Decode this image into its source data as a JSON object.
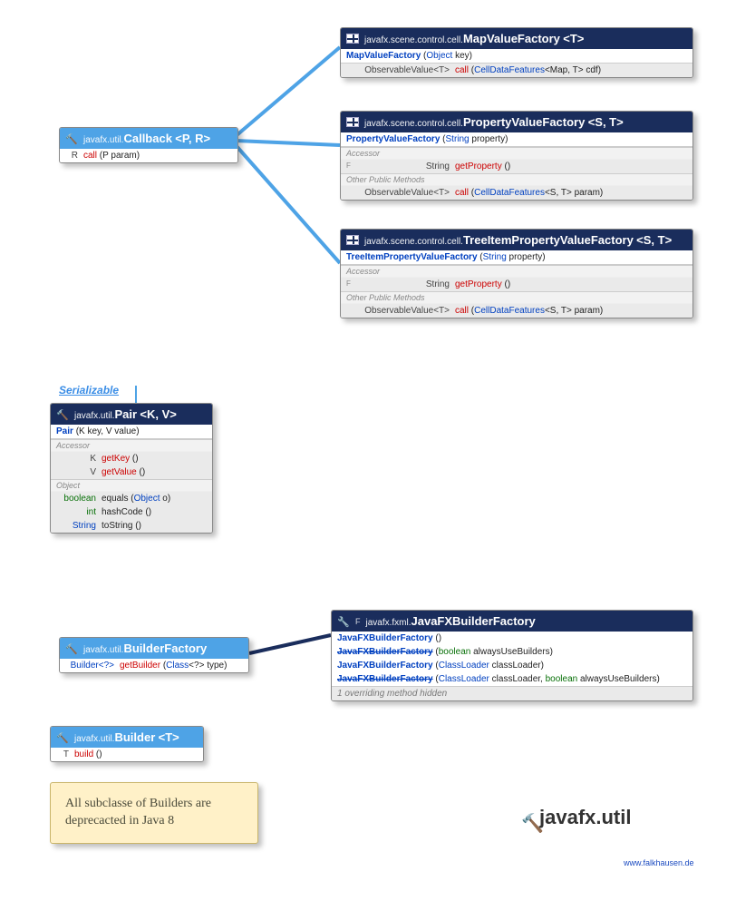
{
  "callback": {
    "pkg": "javafx.util.",
    "cls": "Callback",
    "gen": "<P, R>",
    "row1_ret": "R",
    "row1_name": "call",
    "row1_args": "(P param)"
  },
  "mapValueFactory": {
    "pkg": "javafx.scene.control.cell.",
    "cls": "MapValueFactory",
    "gen": "<T>",
    "ctor_name": "MapValueFactory",
    "ctor_args_pre": "(",
    "ctor_args_type": "Object",
    "ctor_args_post": " key)",
    "row_ret": "ObservableValue<T>",
    "row_name": "call",
    "row_args_pre": "(",
    "row_args_type": "CellDataFeatures",
    "row_args_gen": "<Map, T>",
    "row_args_post": " cdf)"
  },
  "propertyValueFactory": {
    "pkg": "javafx.scene.control.cell.",
    "cls": "PropertyValueFactory",
    "gen": "<S, T>",
    "ctor_name": "PropertyValueFactory",
    "ctor_args_pre": "(",
    "ctor_args_type": "String",
    "ctor_args_post": " property)",
    "sec_accessor": "Accessor",
    "acc_f": "F",
    "acc_ret": "String",
    "acc_name": "getProperty",
    "acc_args": "()",
    "sec_other": "Other Public Methods",
    "row_ret": "ObservableValue<T>",
    "row_name": "call",
    "row_args_pre": "(",
    "row_args_type": "CellDataFeatures",
    "row_args_gen": "<S, T>",
    "row_args_post": " param)"
  },
  "treeItemPVF": {
    "pkg": "javafx.scene.control.cell.",
    "cls": "TreeItemPropertyValueFactory",
    "gen": "<S, T>",
    "ctor_name": "TreeItemPropertyValueFactory",
    "ctor_args_pre": "(",
    "ctor_args_type": "String",
    "ctor_args_post": " property)",
    "sec_accessor": "Accessor",
    "acc_f": "F",
    "acc_ret": "String",
    "acc_name": "getProperty",
    "acc_args": "()",
    "sec_other": "Other Public Methods",
    "row_ret": "ObservableValue<T>",
    "row_name": "call",
    "row_args_pre": "(",
    "row_args_type": "CellDataFeatures",
    "row_args_gen": "<S, T>",
    "row_args_post": " param)"
  },
  "serializable_label": "Serializable",
  "pair": {
    "pkg": "javafx.util.",
    "cls": "Pair",
    "gen": "<K, V>",
    "ctor_name": "Pair",
    "ctor_args": "(K key, V value)",
    "sec_accessor": "Accessor",
    "r1_ret": "K",
    "r1_name": "getKey",
    "r1_args": "()",
    "r2_ret": "V",
    "r2_name": "getValue",
    "r2_args": "()",
    "sec_object": "Object",
    "r3_ret": "boolean",
    "r3_name": "equals",
    "r3_args_pre": "(",
    "r3_args_type": "Object",
    "r3_args_post": " o)",
    "r4_ret": "int",
    "r4_name": "hashCode",
    "r4_args": "()",
    "r5_ret": "String",
    "r5_name": "toString",
    "r5_args": "()"
  },
  "builderFactory": {
    "pkg": "javafx.util.",
    "cls": "BuilderFactory",
    "row_ret": "Builder<?>",
    "row_name": "getBuilder",
    "row_args_pre": "(",
    "row_args_type": "Class",
    "row_args_gen": "<?>",
    "row_args_post": " type)"
  },
  "javaFXBuilderFactory": {
    "pkg": "javafx.fxml.",
    "cls": "JavaFXBuilderFactory",
    "f_marker": "F",
    "c1_name": "JavaFXBuilderFactory",
    "c1_args": "()",
    "c2_name": "JavaFXBuilderFactory",
    "c2_args_pre": "(",
    "c2_args_kw": "boolean",
    "c2_args_post": " alwaysUseBuilders)",
    "c3_name": "JavaFXBuilderFactory",
    "c3_args_pre": "(",
    "c3_args_type": "ClassLoader",
    "c3_args_post": " classLoader)",
    "c4_name": "JavaFXBuilderFactory",
    "c4_args_pre": "(",
    "c4_args_type": "ClassLoader",
    "c4_args_mid": " classLoader, ",
    "c4_args_kw": "boolean",
    "c4_args_post": " alwaysUseBuilders)",
    "override_note": "1 overriding method hidden"
  },
  "builder": {
    "pkg": "javafx.util.",
    "cls": "Builder",
    "gen": "<T>",
    "row_ret": "T",
    "row_name": "build",
    "row_args": "()"
  },
  "note_text": "All subclasse of Builders are deprecacted in Java 8",
  "big_label": "javafx.util",
  "footer": "www.falkhausen.de"
}
